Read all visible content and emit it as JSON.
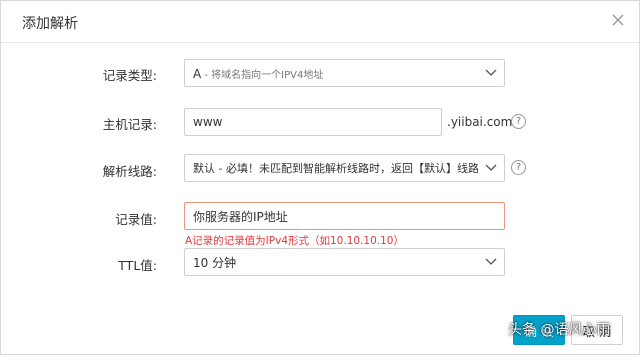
{
  "dialog": {
    "title": "添加解析"
  },
  "form": {
    "record_type": {
      "label": "记录类型:",
      "value_main": "A",
      "value_hint": " - 将域名指向一个IPV4地址"
    },
    "host": {
      "label": "主机记录:",
      "value": "www",
      "suffix": ".yiibai.com"
    },
    "line": {
      "label": "解析线路:",
      "value": "默认 - 必填！未匹配到智能解析线路时，返回【默认】线路..."
    },
    "record_value": {
      "label": "记录值:",
      "value": "你服务器的IP地址",
      "error": "A记录的记录值为IPv4形式（如10.10.10.10）"
    },
    "ttl": {
      "label": "TTL值:",
      "value": "10 分钟"
    }
  },
  "buttons": {
    "ok": "确 认",
    "cancel": "取 消"
  },
  "watermark": "头条 @语风心雨",
  "colors": {
    "primary": "#00a2ca",
    "error": "#e4393c",
    "backdrop": "#6b6b6b"
  },
  "icons": {
    "close": "close-icon",
    "dropdown": "chevron-down-icon",
    "help": "question-circle-icon"
  }
}
